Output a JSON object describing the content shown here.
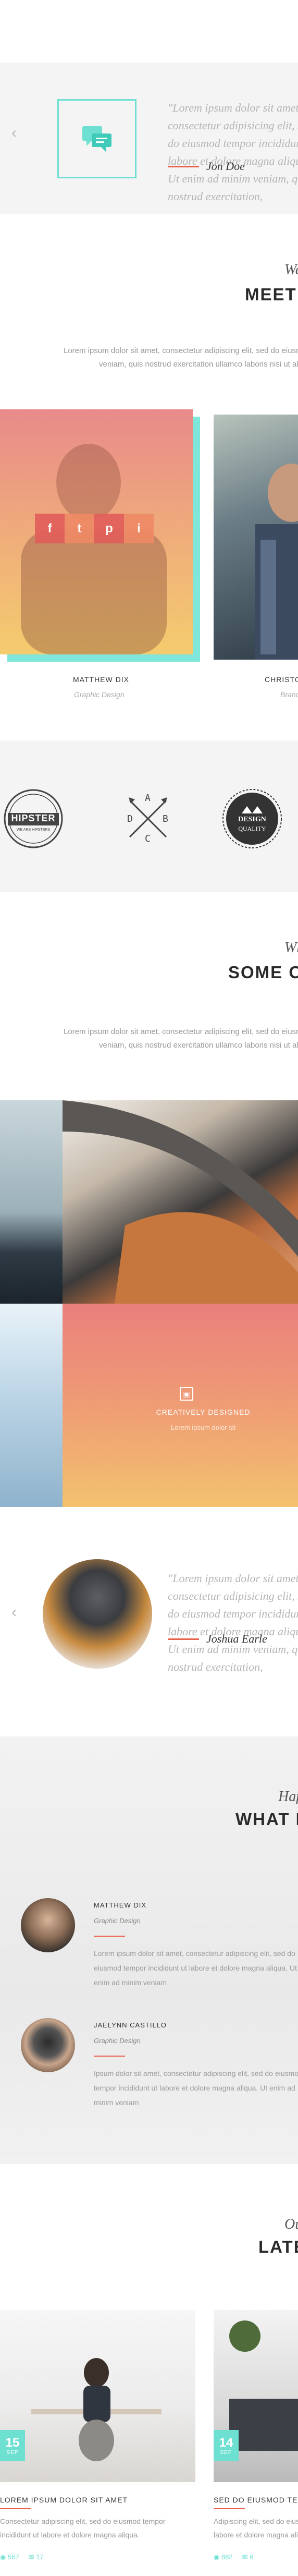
{
  "testimonial_1": {
    "quote": "\"Lorem ipsum dolor sit amet, consectetur adipisicing elit, sed do eiusmod tempor incididunt ut labore et dolore magna aliqua. Ut enim ad minim veniam, quis nostrud exercitation,",
    "author": "Jon Doe",
    "prev_icon": "chevron-left-icon",
    "quote_icon": "chat-bubbles-icon"
  },
  "team": {
    "kicker": "We",
    "title": "MEET OUR TEAM",
    "description_1": "Lorem ipsum dolor sit amet, consectetur adipiscing elit, sed do eiusmod tempor incididunt ut labore et dolore magna aliqua. Ut enim ad minim",
    "description_2": "veniam, quis nostrud exercitation ullamco laboris nisi ut aliquip ex ea commodo consequat.",
    "members": [
      {
        "name": "MATTHEW DIX",
        "role": "Graphic Design"
      },
      {
        "name": "CHRISTOPHER",
        "role": "Branding"
      }
    ],
    "social": [
      "f",
      "t",
      "p",
      "i"
    ]
  },
  "logos": {
    "hipster_top": "HIPSTER",
    "hipster_sub": "WE ARE HIPSTERS",
    "abcd": [
      "A",
      "B",
      "C",
      "D"
    ],
    "quality_top": "DESIGN",
    "quality_bottom": "QUALITY"
  },
  "portfolio": {
    "kicker": "What",
    "title": "SOME OF OUR WORK",
    "description_1": "Lorem ipsum dolor sit amet, consectetur adipiscing elit, sed do eiusmod tempor incididunt ut labore et dolore magna aliqua. Ut enim ad minim",
    "description_2": "veniam, quis nostrud exercitation ullamco laboris nisi ut aliquip ex ea commodo consequat.",
    "featured_title": "CREATIVELY DESIGNED",
    "featured_sub": "Lorem ipsum dolor sit"
  },
  "testimonial_2": {
    "quote": "\"Lorem ipsum dolor sit amet, consectetur adipisicing elit, sed do eiusmod tempor incididunt ut labore et dolore magna aliqua. Ut enim ad minim veniam, quis nostrud exercitation,",
    "author": "Joshua Earle",
    "prev_icon": "chevron-left-icon"
  },
  "people": {
    "kicker": "Happy",
    "title": "WHAT PEOPLE SAY",
    "items": [
      {
        "name": "MATTHEW DIX",
        "role": "Graphic Design",
        "text": "Lorem ipsum dolor sit amet, consectetur adipiscing elit, sed do eiusmod tempor incididunt ut labore et dolore magna aliqua. Ut enim ad minim veniam"
      },
      {
        "name": "JAELYNN CASTILLO",
        "role": "Graphic Design",
        "text": "Ipsum dolor sit amet, consectetur adipiscing elit, sed do eiusmod tempor incididunt ut labore et dolore magna aliqua. Ut enim ad minim veniam"
      }
    ]
  },
  "latest": {
    "kicker": "Our",
    "title": "LATEST NEWS",
    "posts": [
      {
        "day": "15",
        "month": "SEP",
        "title": "LOREM IPSUM DOLOR SIT AMET",
        "text": "Consectetur adipiscing elit, sed do eiusmod tempor incididunt ut labore et dolore magna aliqua.",
        "views": "567",
        "comments": "17"
      },
      {
        "day": "14",
        "month": "SEP",
        "title": "SED DO EIUSMOD TEMPOR",
        "text": "Adipiscing elit, sed do eiusmod tempor incididunt ut labore et dolore magna aliqua.",
        "views": "862",
        "comments": "6"
      }
    ]
  },
  "colors": {
    "accent_teal": "#6ee0d2",
    "accent_coral": "#e8604c"
  }
}
